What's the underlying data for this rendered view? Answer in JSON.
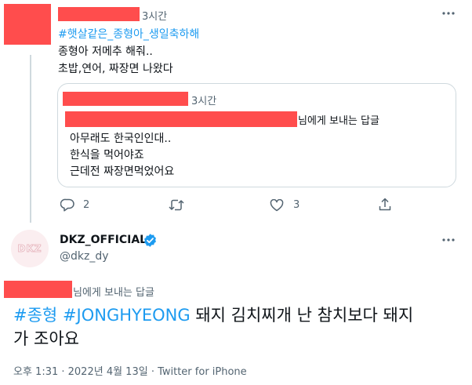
{
  "reply_tweet": {
    "time": "3시간",
    "hashtag": "#햇살같은_종형아_생일축하해",
    "lines": [
      "종형아 저메추 해줘..",
      "초밥,연어, 짜장면 나왔다"
    ],
    "more_icon": "more-horizontal-icon"
  },
  "quoted_tweet": {
    "time": "3시간",
    "reply_to_suffix": "님에게 보내는 답글",
    "lines": [
      "아무래도 한국인인대..",
      "한식을 먹어야죠",
      "근데전 짜장면먹었어요"
    ]
  },
  "actions": {
    "reply_count": "2",
    "retweet_count": "",
    "like_count": "3"
  },
  "main_tweet": {
    "avatar_text": "DKZ",
    "display_name": "DKZ_OFFICIAL",
    "handle": "@dkz_dy",
    "reply_to_suffix": "님에게 보내는 답글",
    "hashtag1": "#종형",
    "hashtag2": "#JONGHYEONG",
    "text_rest": " 돼지 김치찌개 난 참치보다 돼지",
    "text_line2": "가 조아요",
    "meta": "오후 1:31 · 2022년 4월 13일 · Twitter for iPhone"
  },
  "colors": {
    "accent": "#1d9bf0",
    "redaction": "#ff4d4d",
    "muted": "#536471",
    "border": "#cfd9de"
  }
}
